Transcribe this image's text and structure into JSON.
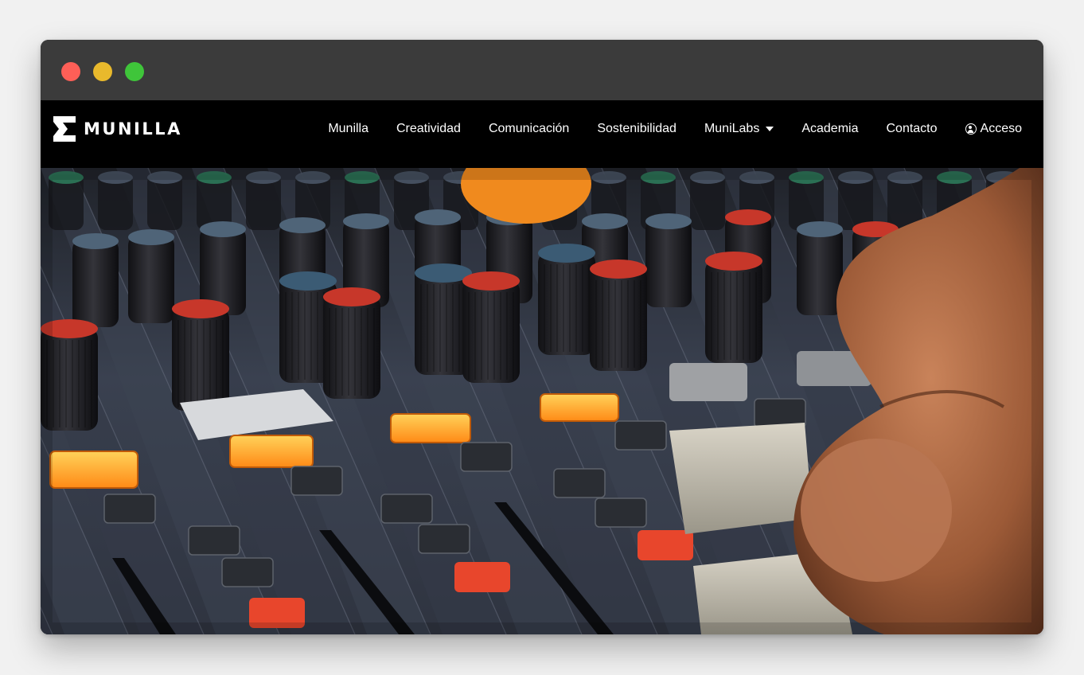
{
  "window": {
    "controls": [
      "close",
      "minimize",
      "zoom"
    ],
    "colors": {
      "close": "#fe5f57",
      "minimize": "#e9b92c",
      "zoom": "#3fc53a",
      "titlebar": "#3b3b3b"
    }
  },
  "brand": {
    "name": "MUNILLA",
    "logo_icon": "sigma-icon"
  },
  "nav": {
    "items": [
      {
        "label": "Munilla"
      },
      {
        "label": "Creatividad"
      },
      {
        "label": "Comunicación"
      },
      {
        "label": "Sostenibilidad"
      },
      {
        "label": "MuniLabs",
        "has_dropdown": true
      },
      {
        "label": "Academia"
      },
      {
        "label": "Contacto"
      },
      {
        "label": "Acceso",
        "icon": "user-circle-icon"
      }
    ]
  },
  "hero": {
    "image_subject": "audio mixing console with a hand adjusting a fader",
    "colors": {
      "panel": "#3a4150",
      "knob": "#1c1c1f",
      "knob_cap_red": "#c7372a",
      "button_orange": "#ff9a1f",
      "button_red": "#e8462c"
    }
  }
}
